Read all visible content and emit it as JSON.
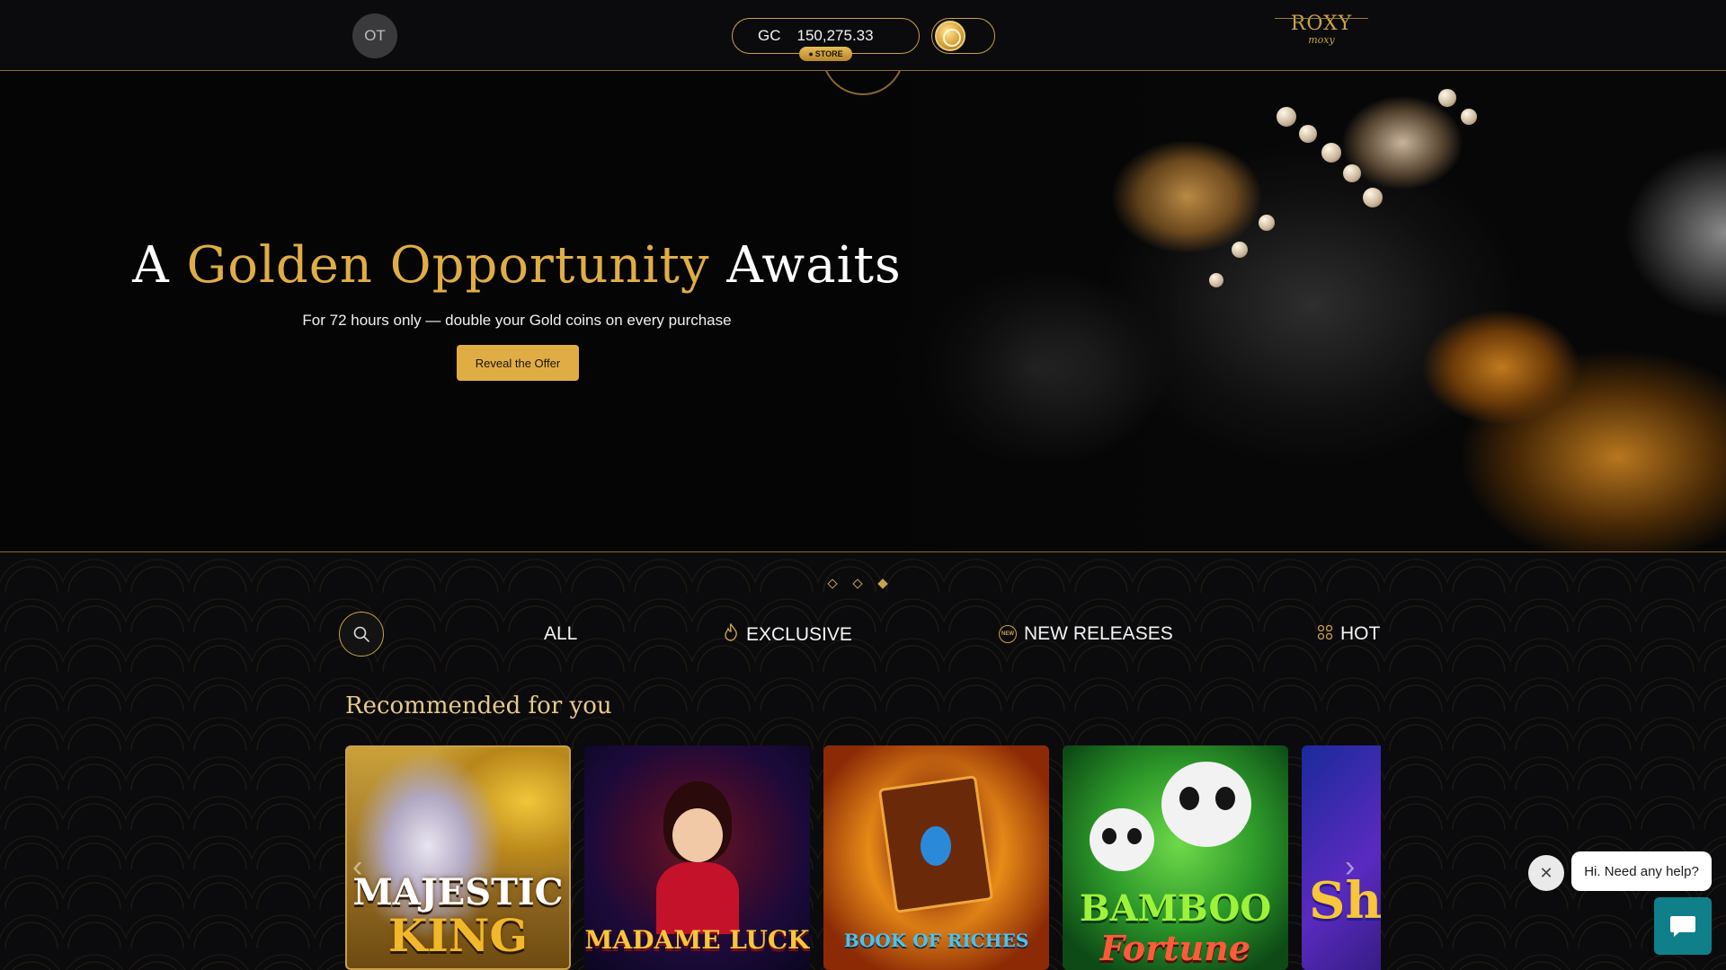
{
  "header": {
    "avatar_initials": "OT",
    "currency": "GC",
    "balance": "150,275.33",
    "store_label": "STORE",
    "logo_main": "ROXY",
    "logo_sub": "moxy"
  },
  "hero": {
    "title_lead": "A",
    "title_highlight": "Golden Opportunity",
    "title_tail": "Awaits",
    "subtitle": "For 72 hours only — double your Gold coins on every purchase",
    "cta_label": "Reveal the Offer",
    "carousel_slide_count": 3,
    "active_slide": 3
  },
  "tabs": {
    "all": "ALL",
    "exclusive": "EXCLUSIVE",
    "new_releases": "NEW RELEASES",
    "new_badge": "NEW",
    "hot": "HOT"
  },
  "recommended": {
    "title": "Recommended for you",
    "games": [
      {
        "name_line1": "MAJESTIC",
        "name_line2": "KING"
      },
      {
        "name_line1": "MADAME LUCK"
      },
      {
        "name_line1": "BOOK OF RICHES"
      },
      {
        "name_line1": "BAMBOO",
        "name_line2": "Fortune"
      },
      {
        "name_line1": "Sh"
      }
    ]
  },
  "help": {
    "message": "Hi. Need any help?"
  },
  "colors": {
    "accent_gold": "#e0ad45",
    "border_gold": "#c9a24a",
    "background": "#0b0b0d",
    "help_teal": "#0f7f8a"
  }
}
